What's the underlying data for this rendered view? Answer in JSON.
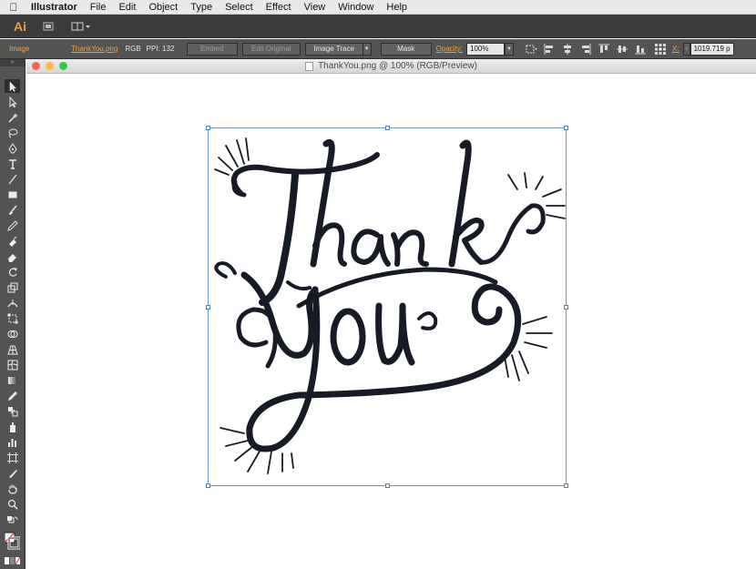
{
  "menubar": {
    "app_name": "Illustrator",
    "items": [
      "File",
      "Edit",
      "Object",
      "Type",
      "Select",
      "Effect",
      "View",
      "Window",
      "Help"
    ]
  },
  "appbar": {
    "logo": "Ai"
  },
  "control_bar": {
    "object_type": "Image",
    "filename": "ThankYou.png",
    "color_mode": "RGB",
    "ppi": "PPI: 132",
    "embed_label": "Embed",
    "edit_original_label": "Edit Original",
    "image_trace_label": "Image Trace",
    "mask_label": "Mask",
    "opacity_label": "Opacity:",
    "opacity_value": "100%",
    "x_label": "X:",
    "x_value": "1019.719 p"
  },
  "document": {
    "title": "ThankYou.png @ 100% (RGB/Preview)",
    "art_text_line1": "Thank",
    "art_text_line2": "You"
  },
  "colors": {
    "accent_orange": "#f0a03c",
    "selection_blue": "#6b93e0",
    "ink": "#161b26",
    "close_light": "#fc605c",
    "minimize_light": "#fdbc40",
    "zoom_light": "#34c84a"
  }
}
